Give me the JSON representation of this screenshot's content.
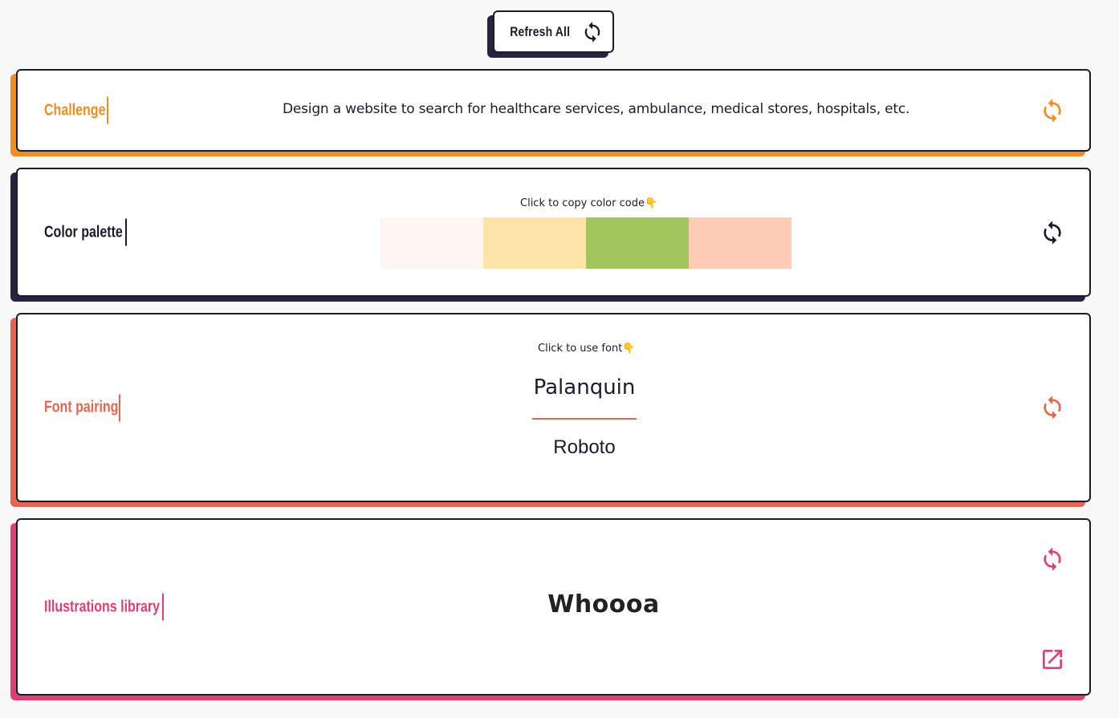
{
  "header": {
    "refresh_all_label": "Refresh All"
  },
  "challenge": {
    "title": "Challenge",
    "accent": "#f28c1e",
    "text": "Design a website to search for healthcare services, ambulance, medical stores, hospitals, etc.",
    "refresh_icon": "refresh-icon"
  },
  "palette": {
    "title": "Color palette",
    "accent": "#26243e",
    "hint": "Click to copy color code👇",
    "colors": [
      "#fff5f3",
      "#fee4a8",
      "#a2c55d",
      "#feccb5"
    ],
    "refresh_icon": "refresh-icon"
  },
  "fonts": {
    "title": "Font pairing",
    "accent": "#e7654c",
    "hint": "Click to use font👇",
    "primary": "Palanquin",
    "secondary": "Roboto",
    "refresh_icon": "refresh-icon"
  },
  "illustrations": {
    "title": "Illustrations library",
    "accent": "#e13f72",
    "name": "Whoooa",
    "refresh_icon": "refresh-icon",
    "open_icon": "external-link-icon"
  }
}
